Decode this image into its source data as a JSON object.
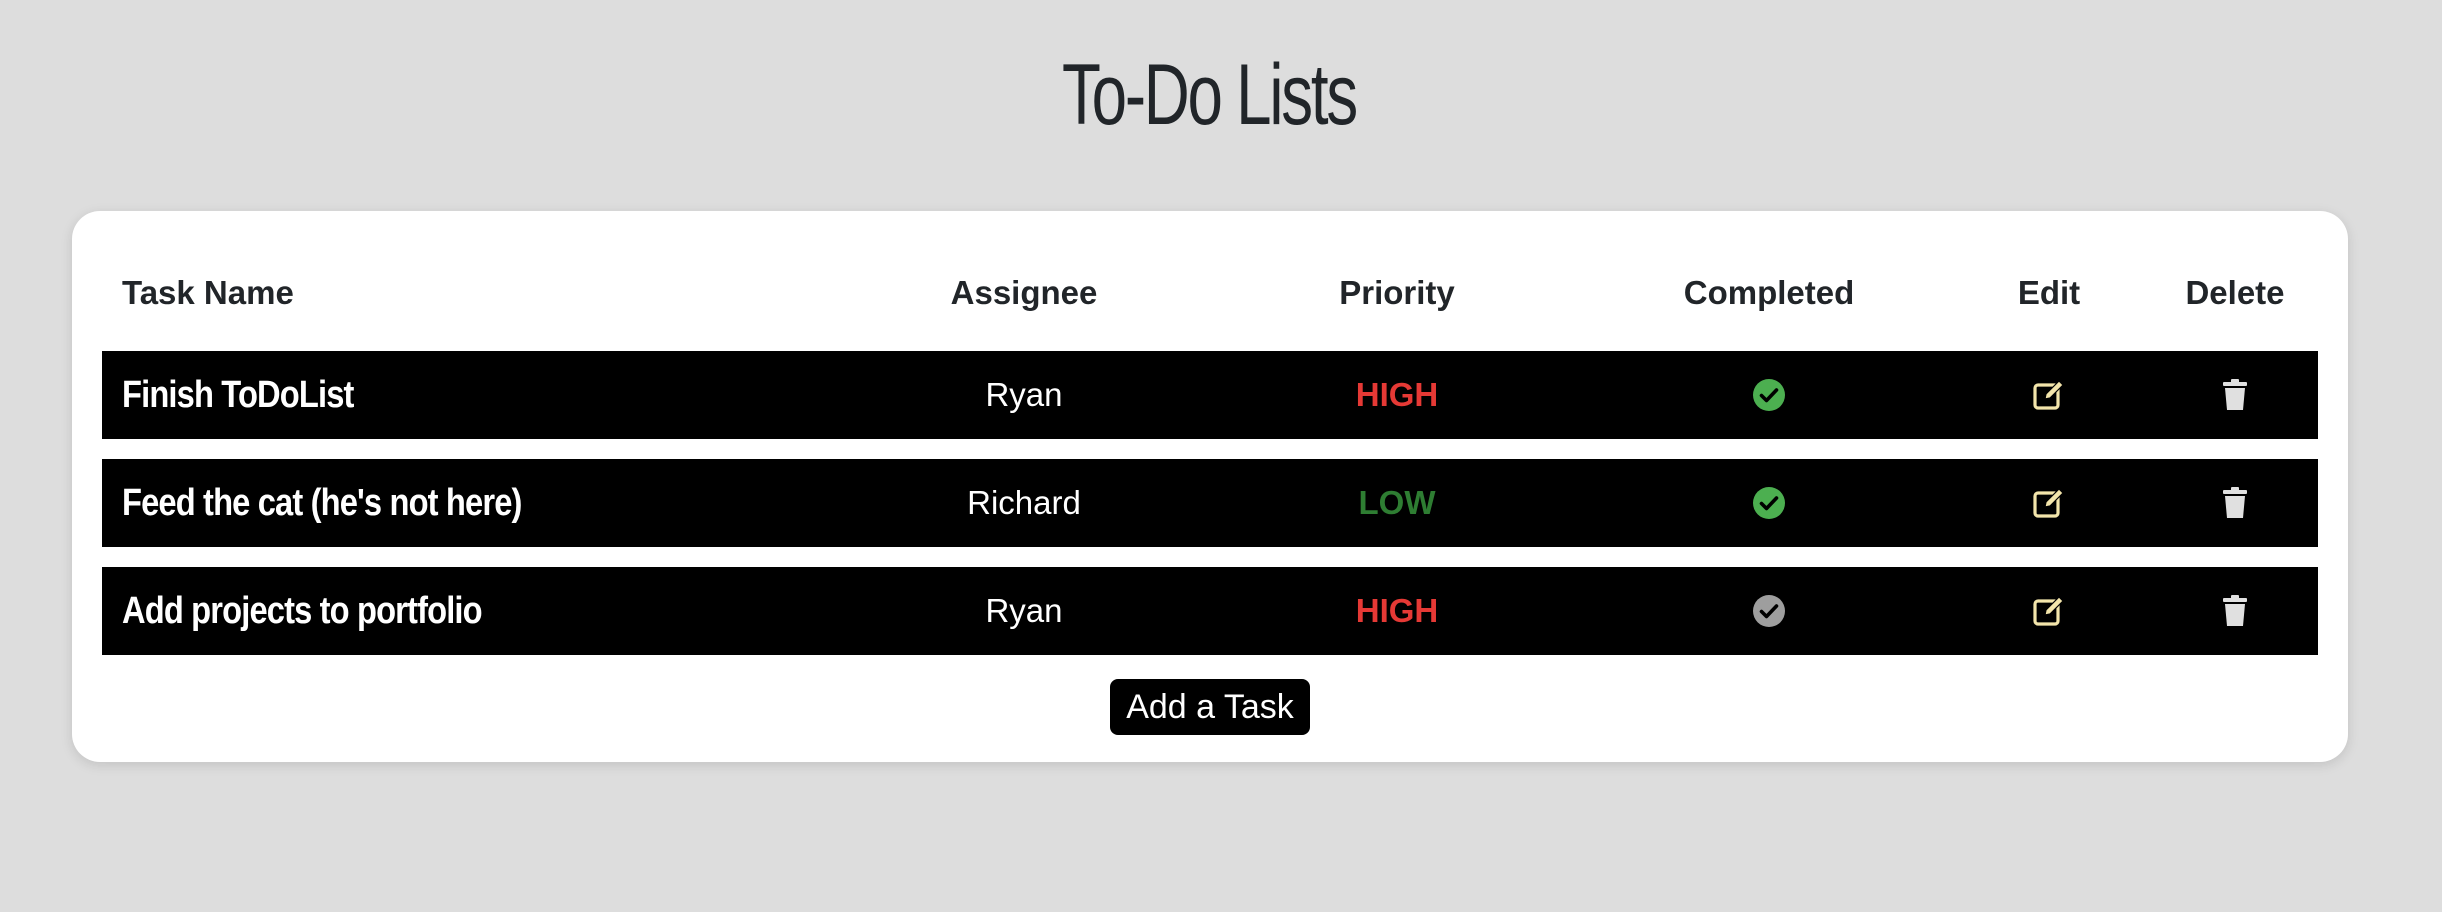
{
  "page": {
    "title": "To-Do Lists"
  },
  "table": {
    "headers": {
      "task_name": "Task Name",
      "assignee": "Assignee",
      "priority": "Priority",
      "completed": "Completed",
      "edit": "Edit",
      "delete": "Delete"
    },
    "rows": [
      {
        "task_name": "Finish ToDoList",
        "assignee": "Ryan",
        "priority": "HIGH",
        "completed": true
      },
      {
        "task_name": "Feed the cat (he's not here)",
        "assignee": "Richard",
        "priority": "LOW",
        "completed": true
      },
      {
        "task_name": "Add projects to portfolio",
        "assignee": "Ryan",
        "priority": "HIGH",
        "completed": false
      }
    ]
  },
  "actions": {
    "add_task_label": "Add a Task"
  },
  "icons": {
    "completed": "check-circle-icon",
    "edit": "edit-icon",
    "delete": "trash-icon"
  },
  "colors": {
    "background": "#dddddd",
    "card": "#ffffff",
    "row": "#000000",
    "priority_high": "#e53935",
    "priority_low": "#2e7d32",
    "completed_true": "#4caf50",
    "completed_false": "#9e9e9e",
    "edit_icon": "#f3e5ab",
    "delete_icon": "#e0e0e0"
  }
}
